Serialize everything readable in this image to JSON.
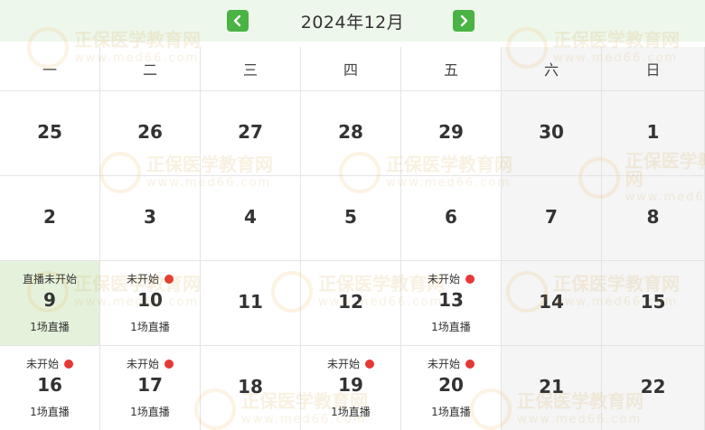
{
  "calendar": {
    "title": "2024年12月",
    "weekdays": [
      "一",
      "二",
      "三",
      "四",
      "五",
      "六",
      "日"
    ],
    "weeks": [
      [
        {
          "day": "25"
        },
        {
          "day": "26"
        },
        {
          "day": "27"
        },
        {
          "day": "28"
        },
        {
          "day": "29"
        },
        {
          "day": "30"
        },
        {
          "day": "1"
        }
      ],
      [
        {
          "day": "2"
        },
        {
          "day": "3"
        },
        {
          "day": "4"
        },
        {
          "day": "5"
        },
        {
          "day": "6"
        },
        {
          "day": "7"
        },
        {
          "day": "8"
        }
      ],
      [
        {
          "day": "9",
          "status": "直播未开始",
          "count": "1场直播",
          "today": true
        },
        {
          "day": "10",
          "status": "未开始",
          "count": "1场直播",
          "dot": true
        },
        {
          "day": "11"
        },
        {
          "day": "12"
        },
        {
          "day": "13",
          "status": "未开始",
          "count": "1场直播",
          "dot": true
        },
        {
          "day": "14"
        },
        {
          "day": "15"
        }
      ],
      [
        {
          "day": "16",
          "status": "未开始",
          "count": "1场直播",
          "dot": true
        },
        {
          "day": "17",
          "status": "未开始",
          "count": "1场直播",
          "dot": true
        },
        {
          "day": "18"
        },
        {
          "day": "19",
          "status": "未开始",
          "count": "1场直播",
          "dot": true
        },
        {
          "day": "20",
          "status": "未开始",
          "count": "1场直播",
          "dot": true
        },
        {
          "day": "21"
        },
        {
          "day": "22"
        }
      ]
    ]
  },
  "watermark": {
    "logo_text": "正保",
    "brand": "医学教育网",
    "url": "www.med66.com"
  },
  "colors": {
    "accent": "#49b344",
    "header_bg": "#eef7ec",
    "today_bg": "#e4f2dc",
    "weekend_bg": "#f5f5f5",
    "dot": "#e53935"
  }
}
